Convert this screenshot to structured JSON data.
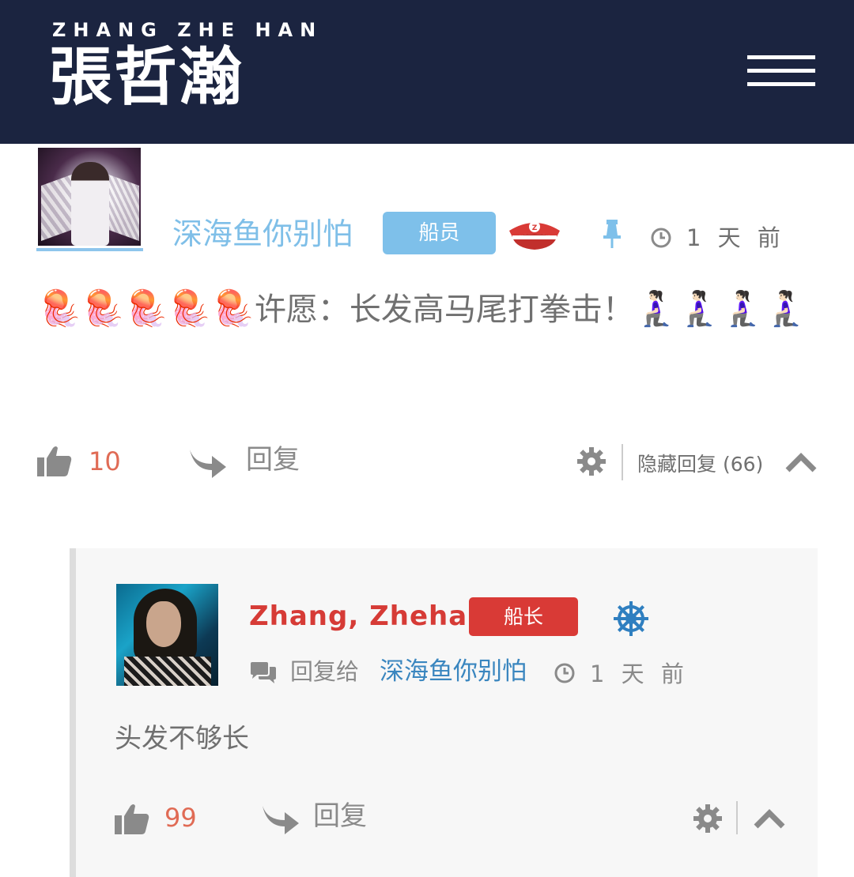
{
  "header": {
    "brand_en": "ZHANG ZHE HAN",
    "brand_cn": "張哲瀚",
    "background": "#1b2440"
  },
  "comment": {
    "username": "深海鱼你别怕",
    "badge": "船员",
    "badge_color": "#7ec0ea",
    "rank_icon": "captain-hat-icon",
    "pinned_icon": "pin-icon",
    "time": "1 天 前",
    "text_prefix": "🪼🪼🪼🪼🪼",
    "text": "许愿：长发高马尾打拳击！",
    "text_suffix": "🧎🏻‍♀️🧎🏻‍♀️🧎🏻‍♀️🧎🏻‍♀️",
    "likes": "10",
    "reply_label": "回复",
    "hide_replies_label": "隐藏回复 (66)"
  },
  "reply": {
    "username": "Zhang, Zhehan",
    "badge": "船长",
    "badge_color": "#d93a36",
    "rank_icon": "ship-wheel-icon",
    "reply_to_label": "回复给",
    "reply_to_user": "深海鱼你别怕",
    "time": "1 天 前",
    "text": "头发不够长",
    "likes": "99",
    "reply_label": "回复"
  }
}
